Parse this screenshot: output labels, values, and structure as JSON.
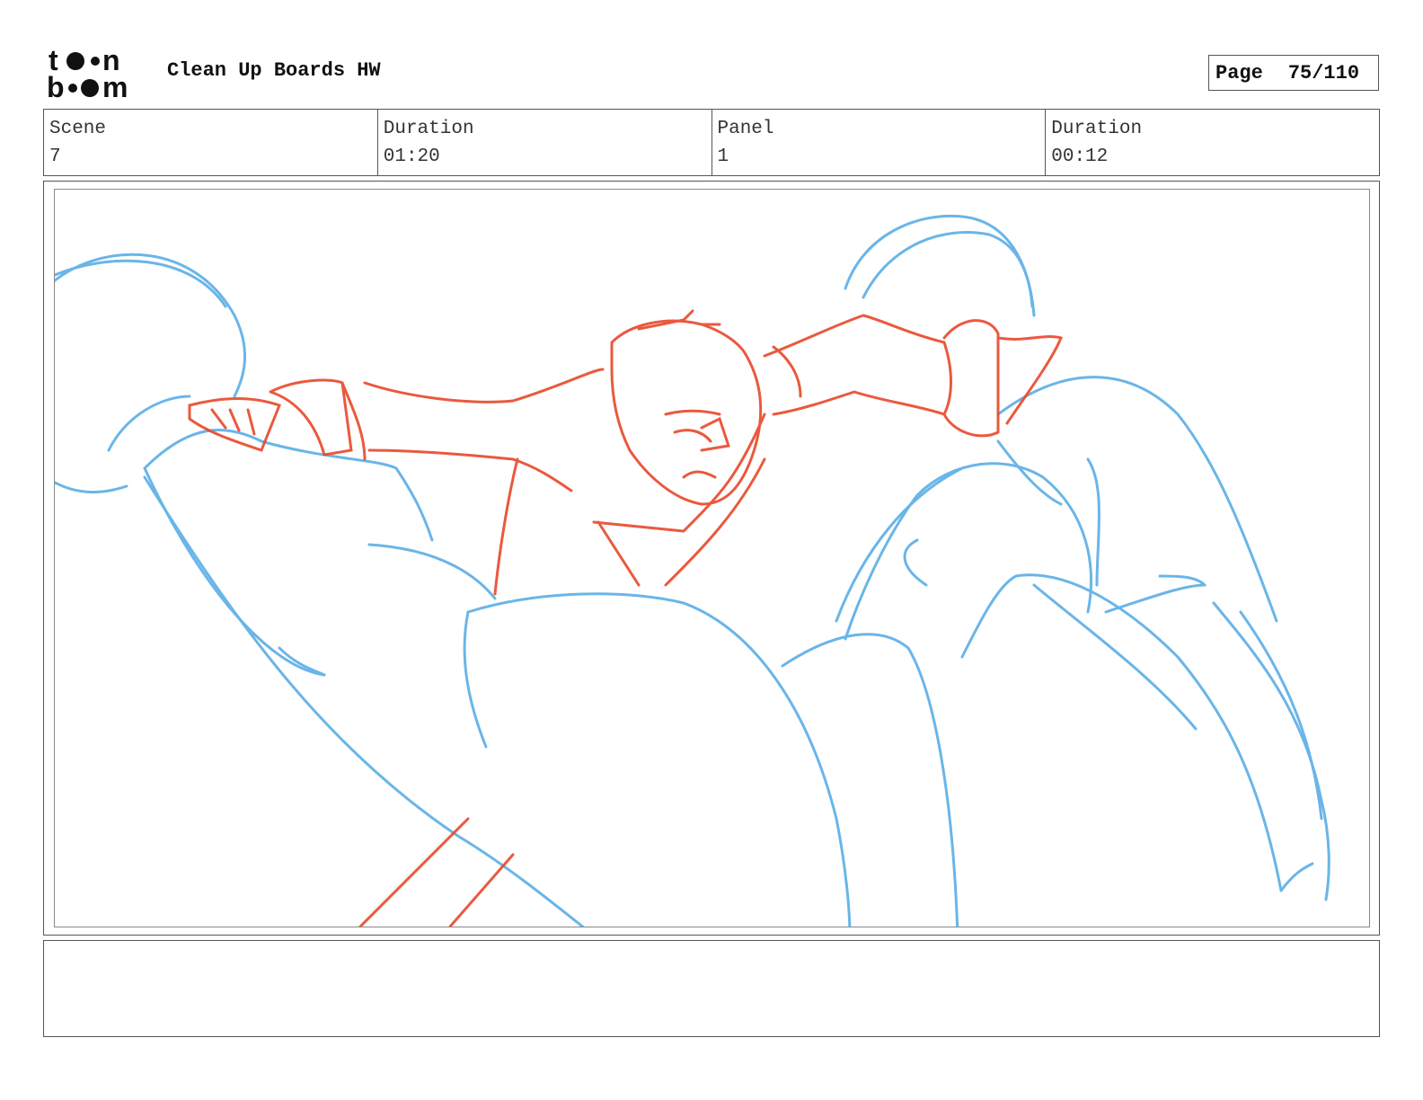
{
  "header": {
    "logo_text_top": "toon",
    "logo_text_bottom": "boom",
    "title": "Clean Up Boards HW",
    "page_label": "Page",
    "page_number": "75/110"
  },
  "info": {
    "scene_label": "Scene",
    "scene_value": "7",
    "scene_duration_label": "Duration",
    "scene_duration_value": "01:20",
    "panel_label": "Panel",
    "panel_value": "1",
    "panel_duration_label": "Duration",
    "panel_duration_value": "00:12"
  },
  "panel": {
    "sketch_colors": {
      "rough": "#5aaee6",
      "character": "#e8482a"
    }
  },
  "notes": {}
}
